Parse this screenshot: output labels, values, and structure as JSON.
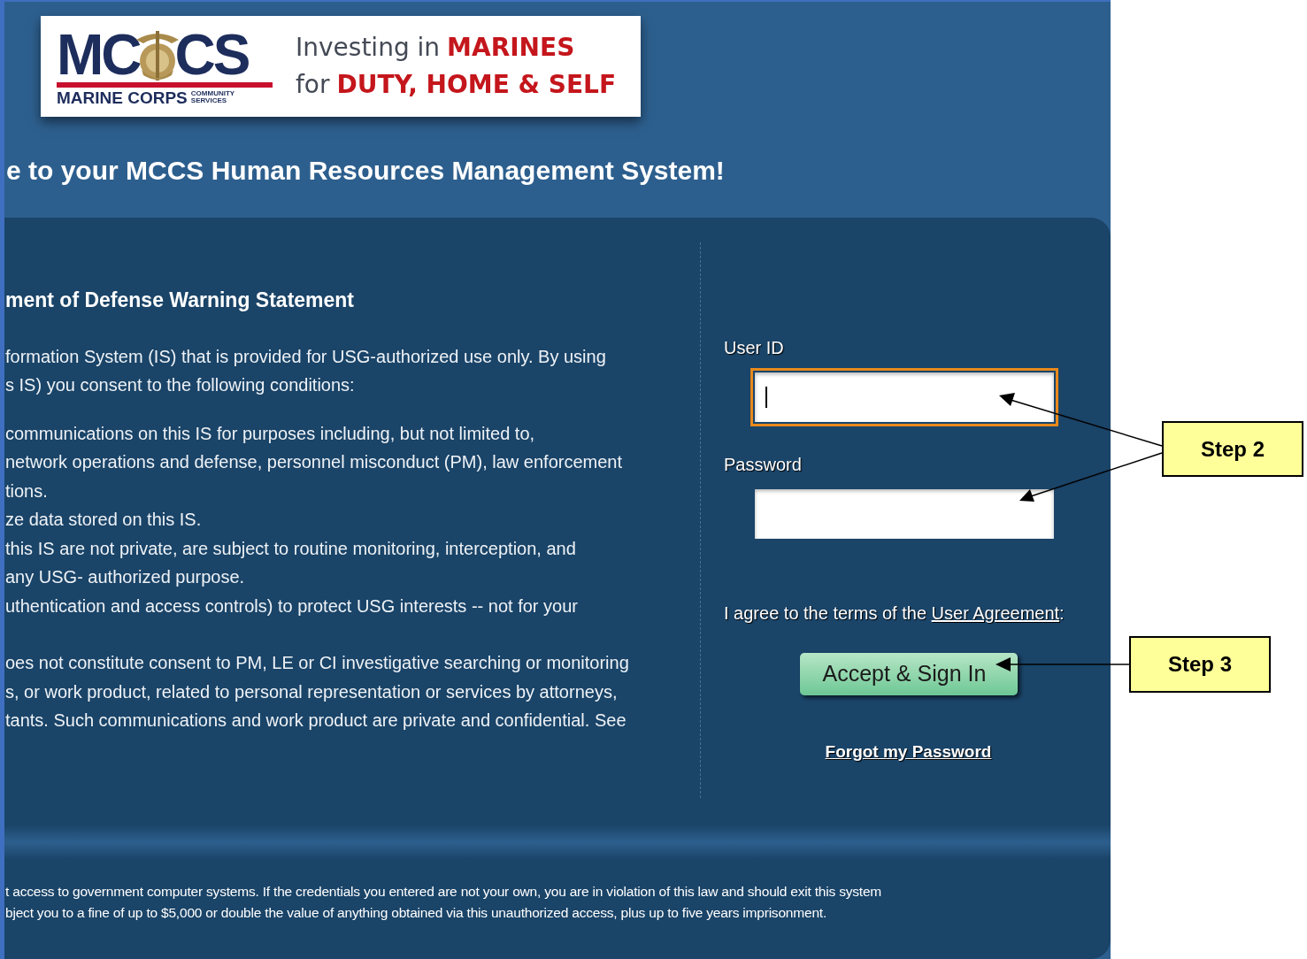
{
  "logo": {
    "letters_left": "MC",
    "letters_right": "CS",
    "org": "MARINE CORPS",
    "sub": [
      "COMMUNITY",
      "SERVICES"
    ]
  },
  "tagline": [
    {
      "plain": "Investing in",
      "highlight": "MARINES"
    },
    {
      "plain": "for",
      "highlight": "DUTY, HOME & SELF"
    }
  ],
  "page_title": "e to your MCCS Human Resources Management System!",
  "warning": {
    "heading": "ment of Defense Warning Statement",
    "paragraphs": [
      [
        "formation System (IS) that is provided for USG-authorized use only. By using",
        "s IS) you consent to the following conditions:"
      ],
      [
        "communications on this IS for purposes including, but not limited to,",
        "network operations and defense, personnel misconduct (PM), law enforcement",
        "tions.",
        "ze data stored on this IS.",
        "this IS are not private, are subject to routine monitoring, interception, and",
        "any USG- authorized purpose.",
        "uthentication and access controls) to protect USG interests -- not for your"
      ],
      [
        "oes not constitute consent to PM, LE or CI investigative searching or monitoring",
        "s, or work product, related to personal representation or services by attorneys,",
        "tants. Such communications and work product are private and confidential. See"
      ]
    ]
  },
  "login": {
    "user_id_label": "User ID",
    "user_id_focused": true,
    "password_label": "Password",
    "password_focused": false,
    "agree_text": "I agree to the terms of the",
    "agree_link": "User Agreement",
    "agree_suffix": ":",
    "button": "Accept & Sign In",
    "forgot": "Forgot my Password"
  },
  "footer": [
    "t access to government computer systems. If the credentials you entered are not your own, you are in violation of this law and should exit this system",
    "bject you to a fine of up to $5,000 or double the value of anything obtained via this unauthorized access, plus up to five years imprisonment."
  ],
  "callouts": [
    {
      "label": "Step 2"
    },
    {
      "label": "Step 3"
    }
  ]
}
